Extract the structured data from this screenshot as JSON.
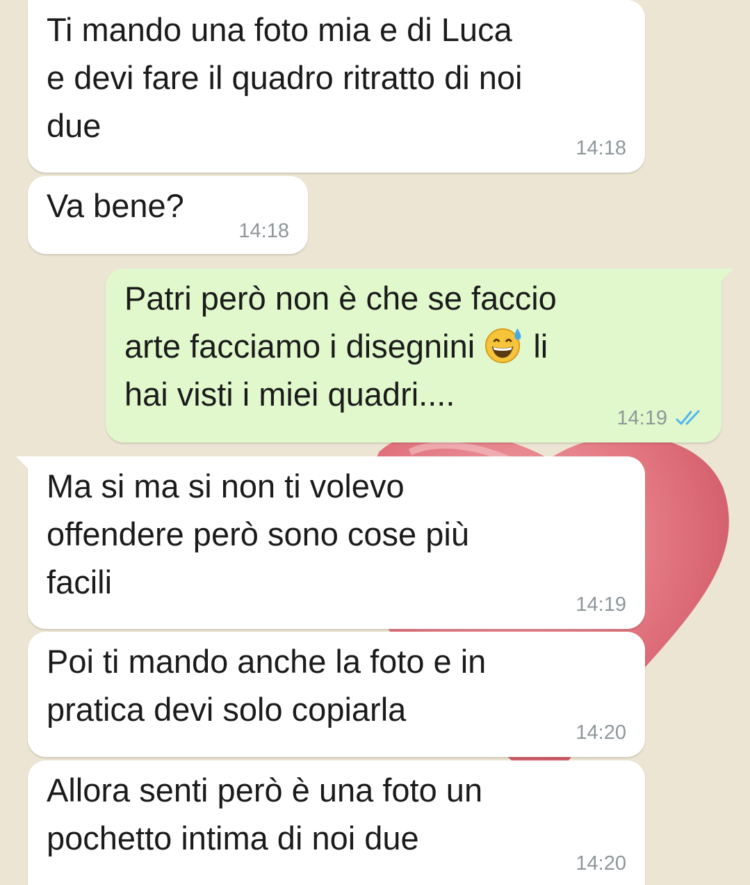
{
  "chat": {
    "messages": [
      {
        "direction": "incoming",
        "text": "Ti mando una foto mia e di Luca\ne devi fare il quadro ritratto di noi\ndue",
        "time": "14:18"
      },
      {
        "direction": "incoming",
        "text": "Va bene?",
        "time": "14:18"
      },
      {
        "direction": "outgoing",
        "text_before": "Patri però non è che se faccio\narte facciamo i disegnini ",
        "emoji": "grinning-face-with-sweat-emoji",
        "text_after": " li\nhai visti i miei quadri....",
        "time": "14:19",
        "status": "read"
      },
      {
        "direction": "incoming",
        "text": "Ma si ma si non ti volevo\noffendere però sono cose più\nfacili",
        "time": "14:19"
      },
      {
        "direction": "incoming",
        "text": "Poi ti mando anche la foto e in\npratica devi solo copiarla",
        "time": "14:20"
      },
      {
        "direction": "incoming",
        "text": "Allora senti però è una foto un\npochetto intima di noi due",
        "time": "14:20"
      }
    ]
  },
  "colors": {
    "wallpaper": "#ece5d3",
    "incoming_bubble": "#ffffff",
    "outgoing_bubble": "#e1f8cc",
    "timestamp": "#8e969a",
    "read_receipt": "#4fb6ec",
    "heart": "#e0717c"
  },
  "icons": {
    "read_receipt": "double-check-icon",
    "emoji": "grinning-face-with-sweat-emoji"
  }
}
